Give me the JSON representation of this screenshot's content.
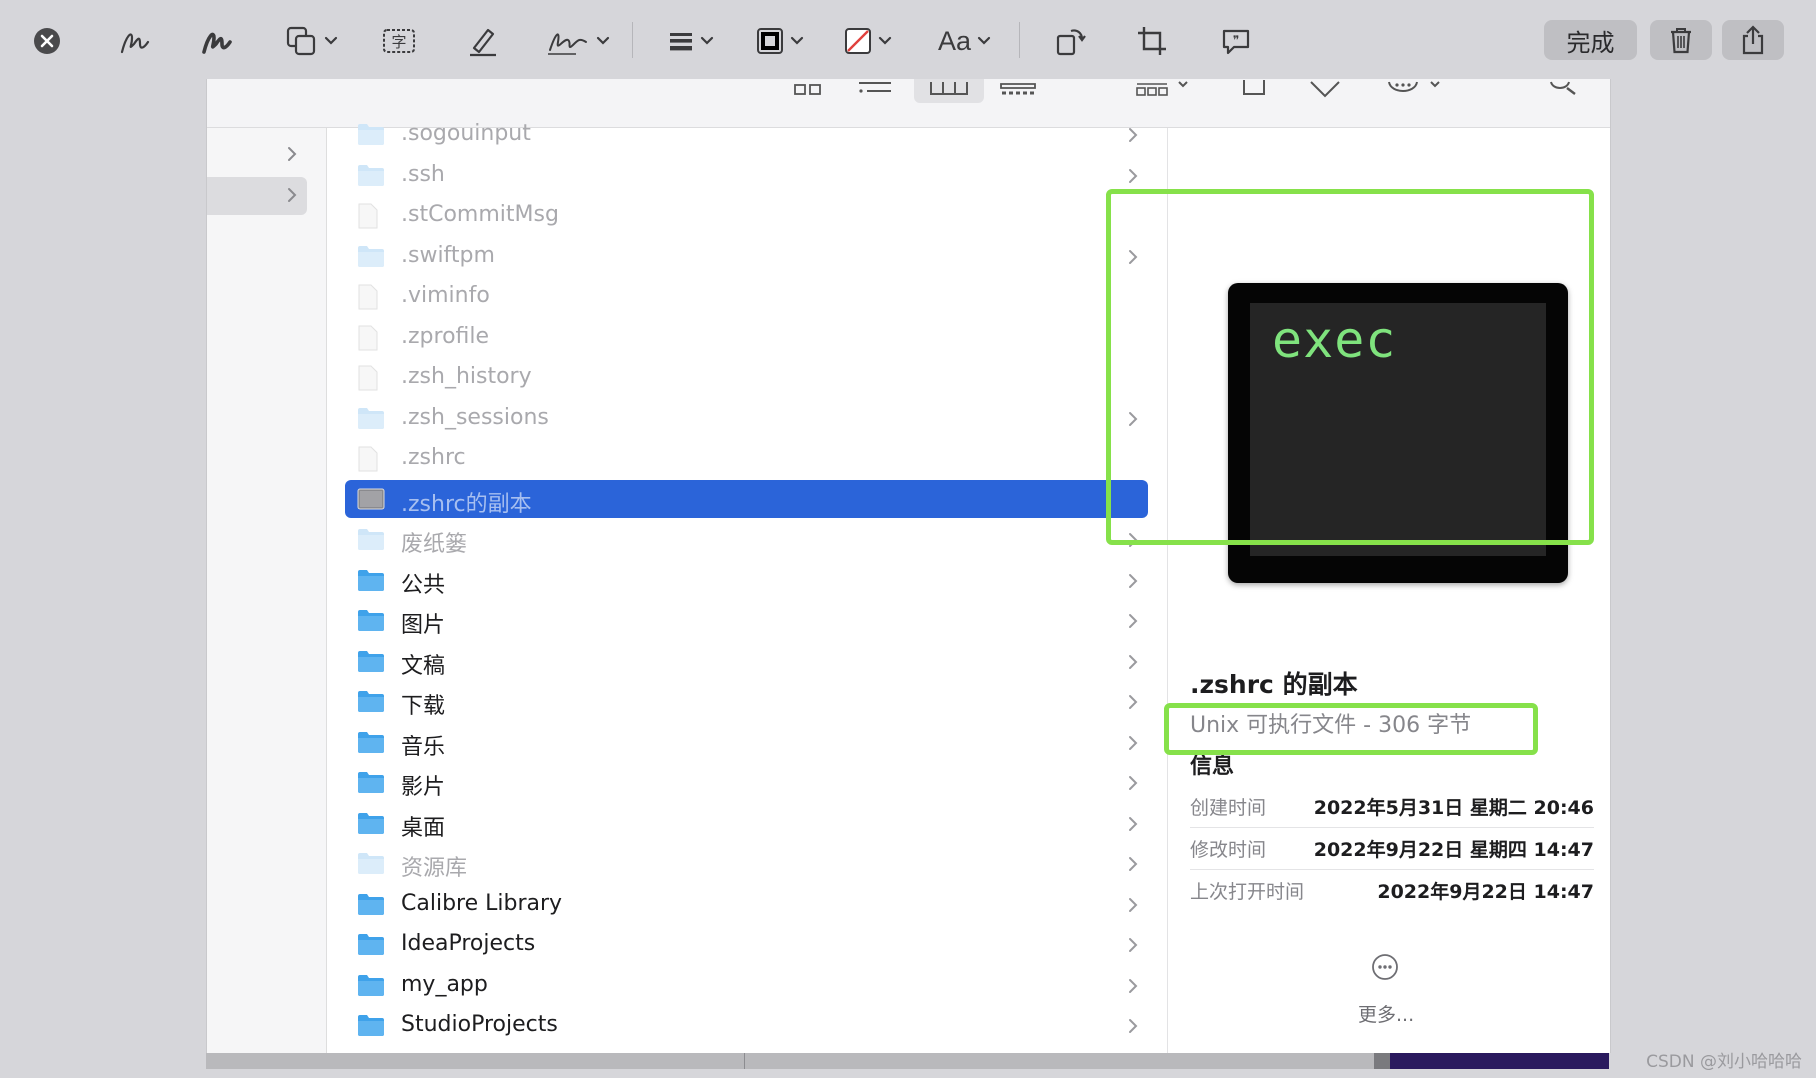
{
  "toolbar": {
    "done_label": "完成",
    "text_style_label": "Aa",
    "tools": [
      "close-icon",
      "sketch-icon",
      "draw-icon",
      "shapes-icon",
      "text-box-icon",
      "highlight-icon",
      "sign-icon",
      "line-style-icon",
      "border-color-icon",
      "fill-color-icon",
      "text-style-icon",
      "rotate-icon",
      "crop-icon",
      "description-icon"
    ],
    "border_color": "#000000",
    "fill_color": "#e0403c"
  },
  "file_list": [
    {
      "name": ".sogouinput",
      "type": "folder",
      "dim": true,
      "has_children": true
    },
    {
      "name": ".ssh",
      "type": "folder",
      "dim": true,
      "has_children": true
    },
    {
      "name": ".stCommitMsg",
      "type": "file",
      "dim": true,
      "has_children": false
    },
    {
      "name": ".swiftpm",
      "type": "folder",
      "dim": true,
      "has_children": true
    },
    {
      "name": ".viminfo",
      "type": "file",
      "dim": true,
      "has_children": false
    },
    {
      "name": ".zprofile",
      "type": "file",
      "dim": true,
      "has_children": false
    },
    {
      "name": ".zsh_history",
      "type": "file",
      "dim": true,
      "has_children": false
    },
    {
      "name": ".zsh_sessions",
      "type": "folder",
      "dim": true,
      "has_children": true
    },
    {
      "name": ".zshrc",
      "type": "file",
      "dim": true,
      "has_children": false
    },
    {
      "name": ".zshrc的副本",
      "type": "exec",
      "dim": true,
      "selected": true,
      "has_children": false
    },
    {
      "name": "废纸篓",
      "type": "folder",
      "dim": true,
      "has_children": true
    },
    {
      "name": "公共",
      "type": "folder",
      "dim": false,
      "has_children": true
    },
    {
      "name": "图片",
      "type": "folder",
      "dim": false,
      "has_children": true
    },
    {
      "name": "文稿",
      "type": "folder",
      "dim": false,
      "has_children": true
    },
    {
      "name": "下载",
      "type": "folder",
      "dim": false,
      "has_children": true
    },
    {
      "name": "音乐",
      "type": "folder",
      "dim": false,
      "has_children": true
    },
    {
      "name": "影片",
      "type": "folder",
      "dim": false,
      "has_children": true
    },
    {
      "name": "桌面",
      "type": "folder",
      "dim": false,
      "has_children": true
    },
    {
      "name": "资源库",
      "type": "folder",
      "dim": true,
      "has_children": true
    },
    {
      "name": "Calibre Library",
      "type": "folder",
      "dim": false,
      "has_children": true
    },
    {
      "name": "IdeaProjects",
      "type": "folder",
      "dim": false,
      "has_children": true
    },
    {
      "name": "my_app",
      "type": "folder",
      "dim": false,
      "has_children": true
    },
    {
      "name": "StudioProjects",
      "type": "folder",
      "dim": false,
      "has_children": true
    }
  ],
  "preview": {
    "thumbnail_text": "exec",
    "file_name": ".zshrc 的副本",
    "file_kind": "Unix 可执行文件 - 306 字节",
    "section_title": "信息",
    "info": [
      {
        "label": "创建时间",
        "value": "2022年5月31日 星期二 20:46"
      },
      {
        "label": "修改时间",
        "value": "2022年9月22日 星期四 14:47"
      },
      {
        "label": "上次打开时间",
        "value": "2022年9月22日 14:47"
      }
    ],
    "more_label": "更多..."
  },
  "watermark": "CSDN @刘小哈哈哈",
  "colors": {
    "selection": "#2b64d9",
    "annotation": "#86e14a",
    "folder": "#5fb4f0"
  }
}
